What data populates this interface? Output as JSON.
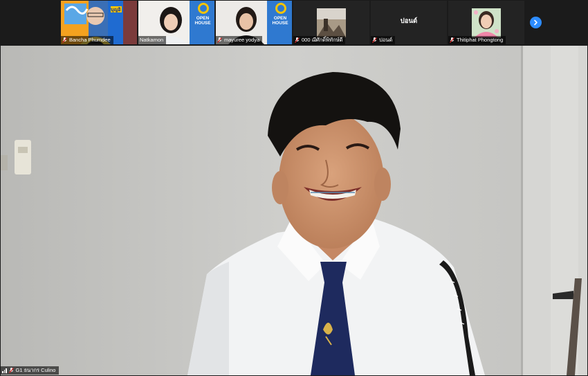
{
  "participants": [
    {
      "name": "Bancha Phumdee",
      "muted": true
    },
    {
      "name": "Natkamon",
      "muted": false
    },
    {
      "name": "mayuree yodya",
      "muted": true
    },
    {
      "name": "000 ฌีศักดิ์พิทักษ์ดี",
      "muted": true
    },
    {
      "name": "ปอนด์",
      "display_text": "ปอนด์",
      "muted": true
    },
    {
      "name": "Thitiphat Phongtong",
      "muted": true
    }
  ],
  "open_house": {
    "title_line1": "OPEN",
    "title_line2": "HOUSE",
    "subtitle": "สาขาวิชาเทคโนโลยีสารสนเทศและการสื่อสาร"
  },
  "banner_text": "บุญอิ",
  "active_speaker": {
    "name": "G1 ธนากร Culino",
    "muted": true
  },
  "colors": {
    "zoom_blue": "#2d8cff",
    "mute_red": "#e02828",
    "strip_bg": "#1b1b1b"
  },
  "icons": {
    "next_page": "chevron-right-icon",
    "mute": "mic-muted-icon",
    "signal": "signal-strength-icon"
  }
}
